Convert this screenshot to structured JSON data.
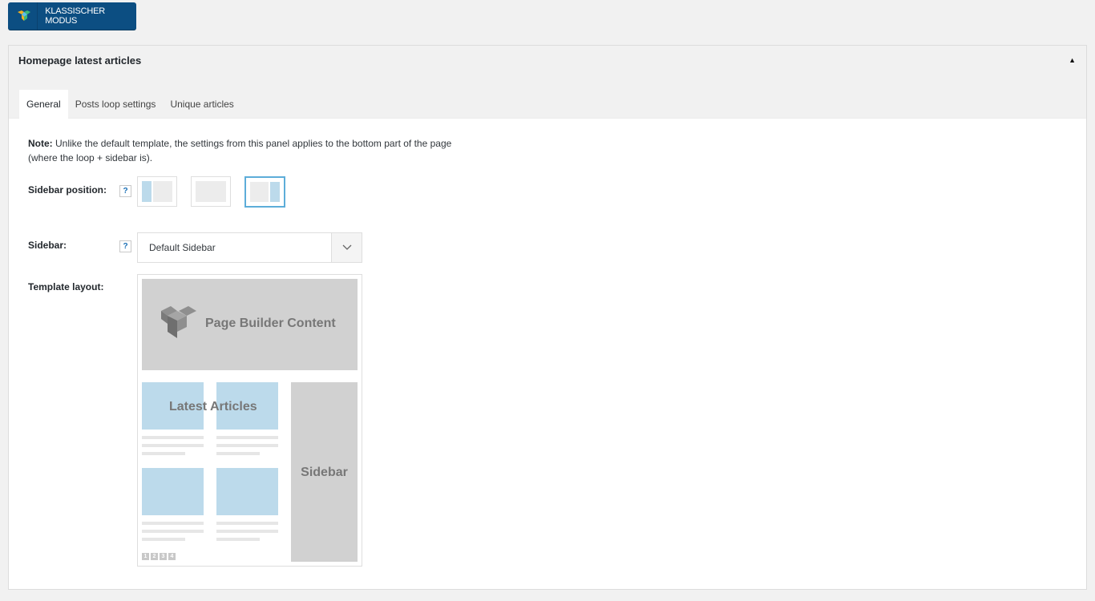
{
  "toolbar": {
    "classic_mode_label": "KLASSISCHER MODUS"
  },
  "panel": {
    "title": "Homepage latest articles",
    "collapse_glyph": "▲",
    "tabs": [
      {
        "label": "General",
        "active": true
      },
      {
        "label": "Posts loop settings",
        "active": false
      },
      {
        "label": "Unique articles",
        "active": false
      }
    ]
  },
  "general": {
    "note_prefix": "Note:",
    "note_text": " Unlike the default template, the settings from this panel applies to the bottom part of the page (where the loop + sidebar is).",
    "sidebar_position_label": "Sidebar position:",
    "sidebar_positions": [
      "left",
      "none",
      "right"
    ],
    "sidebar_position_selected": "right",
    "sidebar_label": "Sidebar:",
    "sidebar_value": "Default Sidebar",
    "help_glyph": "?",
    "template_layout_label": "Template layout:"
  },
  "template_preview": {
    "page_builder_text": "Page Builder Content",
    "latest_articles_text": "Latest Articles",
    "sidebar_text": "Sidebar",
    "pagination": [
      "1",
      "2",
      "3",
      "4"
    ]
  },
  "colors": {
    "button_bg": "#0c4e82",
    "selected_border": "#5dadd9",
    "sidebar_highlight": "#bcdaeb"
  }
}
